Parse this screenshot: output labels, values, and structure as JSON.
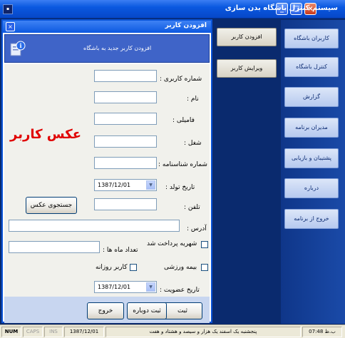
{
  "app": {
    "title": "سیستم کنترل باشگاه بدن سازی",
    "icon_name": "app-icon"
  },
  "child_window": {
    "title": "افزودن کاربر",
    "banner_text": "افزودن کاربر جدید به باشگاه",
    "banner_icon": "info-icon"
  },
  "form": {
    "user_number_label": "شماره کاربری :",
    "name_label": "نام :",
    "family_label": "فامیلی :",
    "job_label": "شغل :",
    "id_number_label": "شماره شناسنامه :",
    "birth_date_label": "تاریخ تولد :",
    "birth_date_value": "1387/12/01",
    "phone_label": "تلفن :",
    "address_label": "آدرس :",
    "paid_label": "شهریه پرداخت شد",
    "months_label": "تعداد ماه ها :",
    "insurance_label": "بیمه ورزشی",
    "daily_label": "کاربر روزانه",
    "membership_date_label": "تاریخ عضویت :",
    "membership_date_value": "1387/12/01",
    "photo_placeholder": "عکس کاربر",
    "photo_search_button": "جستجوی عکس"
  },
  "actions": {
    "save": "ثبت",
    "save_duplicate": "ثبت دوباره",
    "exit": "خروج"
  },
  "submenu": {
    "add_user": "افزودن کاربر",
    "edit_user": "ویرایش کاربر"
  },
  "nav": {
    "items": [
      "کاربران باشگاه",
      "کنترل باشگاه",
      "گزارش",
      "مدیران برنامه",
      "پشتیبان و بازیابی",
      "درباره",
      "خروج از برنامه"
    ]
  },
  "statusbar": {
    "num": "NUM",
    "caps": "CAPS",
    "ins": "INS",
    "date": "1387/12/01",
    "date_text": "پنجشنبه یک اسفند یک هزار و سیصد و هشتاد و هفت",
    "time": "07:48 ب.ظ"
  }
}
